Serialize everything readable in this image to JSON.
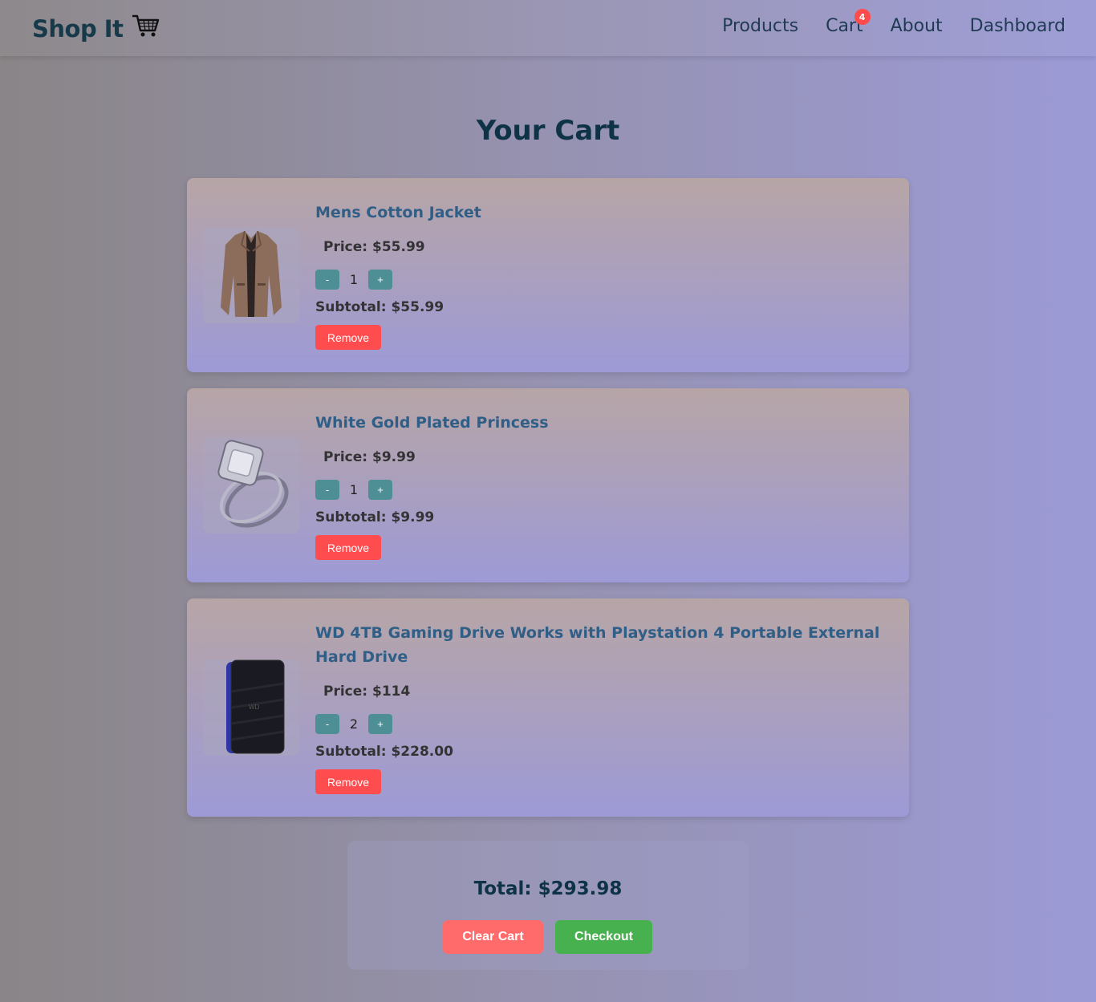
{
  "header": {
    "brand": "Shop It",
    "brand_icon": "shopping-cart-icon",
    "nav": [
      {
        "label": "Products"
      },
      {
        "label": "Cart",
        "badge": "4"
      },
      {
        "label": "About"
      },
      {
        "label": "Dashboard"
      }
    ]
  },
  "main": {
    "title": "Your Cart",
    "items": [
      {
        "title": "Mens Cotton Jacket",
        "price": "Price: $55.99",
        "qty_minus": "-",
        "qty": "1",
        "qty_plus": "+",
        "subtotal": "Subtotal: $55.99",
        "remove": "Remove",
        "image": "jacket-image"
      },
      {
        "title": "White Gold Plated Princess",
        "price": "Price: $9.99",
        "qty_minus": "-",
        "qty": "1",
        "qty_plus": "+",
        "subtotal": "Subtotal: $9.99",
        "remove": "Remove",
        "image": "ring-image"
      },
      {
        "title": "WD 4TB Gaming Drive Works with Playstation 4 Portable External Hard Drive",
        "price": "Price: $114",
        "qty_minus": "-",
        "qty": "2",
        "qty_plus": "+",
        "subtotal": "Subtotal: $228.00",
        "remove": "Remove",
        "image": "hard-drive-image"
      }
    ],
    "summary": {
      "total": "Total: $293.98",
      "clear_label": "Clear Cart",
      "checkout_label": "Checkout"
    }
  },
  "colors": {
    "title": "#0f3346",
    "item_title": "#2f5e86",
    "qty_button": "#4e8f95",
    "remove": "#ff4d4f",
    "clear": "#ff6b6b",
    "checkout": "#48b14f",
    "badge": "#ff4b4b"
  }
}
